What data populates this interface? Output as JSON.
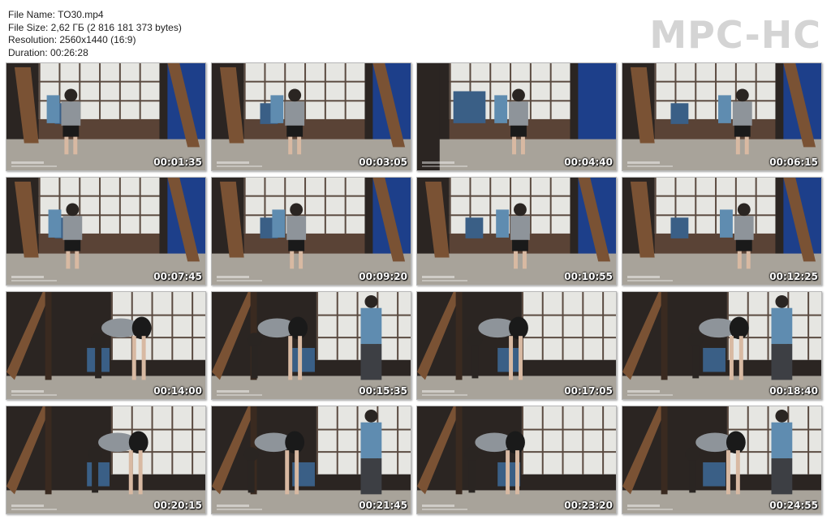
{
  "file_info": {
    "name": "File Name: TO30.mp4",
    "size": "File Size: 2,62 ГБ (2 816 181 373 bytes)",
    "resolution": "Resolution: 2560x1440 (16:9)",
    "duration": "Duration: 00:26:28"
  },
  "logo": "MPC-HC",
  "thumbnails": [
    {
      "time": "00:01:35",
      "scene": "room-wide"
    },
    {
      "time": "00:03:05",
      "scene": "room-wide"
    },
    {
      "time": "00:04:40",
      "scene": "room-close"
    },
    {
      "time": "00:06:15",
      "scene": "room-wide"
    },
    {
      "time": "00:07:45",
      "scene": "room-wide"
    },
    {
      "time": "00:09:20",
      "scene": "room-wide"
    },
    {
      "time": "00:10:55",
      "scene": "room-wide"
    },
    {
      "time": "00:12:25",
      "scene": "room-wide"
    },
    {
      "time": "00:14:00",
      "scene": "frame-side"
    },
    {
      "time": "00:15:35",
      "scene": "frame-side"
    },
    {
      "time": "00:17:05",
      "scene": "frame-side"
    },
    {
      "time": "00:18:40",
      "scene": "frame-side"
    },
    {
      "time": "00:20:15",
      "scene": "frame-side"
    },
    {
      "time": "00:21:45",
      "scene": "frame-side"
    },
    {
      "time": "00:23:20",
      "scene": "frame-side"
    },
    {
      "time": "00:24:55",
      "scene": "frame-side"
    }
  ],
  "colors": {
    "wall_dark": "#2b2522",
    "screen_panel": "#e6e6e2",
    "curtain_blue": "#1d3f8a",
    "floor": "#a8a39a",
    "wood_frame": "#7a5234",
    "chair_blue": "#3a5f86",
    "shirt_blue": "#5f8cb0",
    "blouse_gray": "#8e949a",
    "skirt_black": "#1a1a1a"
  }
}
